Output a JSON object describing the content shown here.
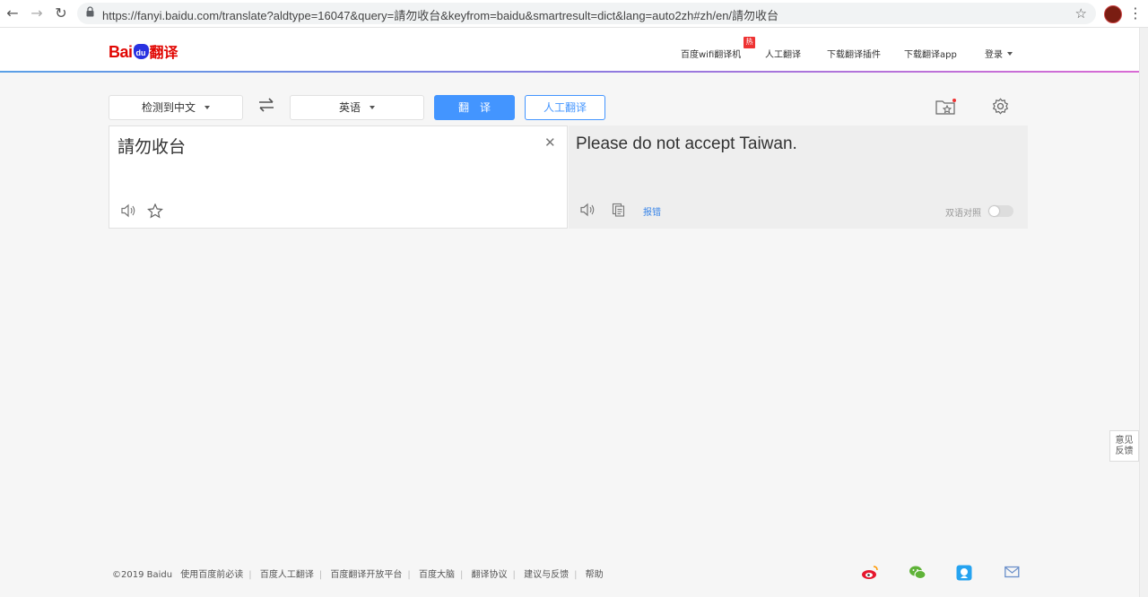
{
  "browser": {
    "url": "https://fanyi.baidu.com/translate?aldtype=16047&query=請勿收台&keyfrom=baidu&smartresult=dict&lang=auto2zh#zh/en/請勿收台",
    "icons": {
      "back": "back-arrow-icon",
      "forward": "forward-arrow-icon",
      "reload": "reload-icon",
      "lock": "lock-icon",
      "bookmark": "star-icon",
      "menu": "kebab-menu-icon"
    }
  },
  "header": {
    "logo": {
      "bai": "Bai",
      "du": "du",
      "fanyi": "翻译"
    },
    "nav": {
      "wifi": "百度wifi翻译机",
      "hot_badge": "热",
      "human": "人工翻译",
      "plugin": "下载翻译插件",
      "app": "下载翻译app",
      "login": "登录"
    }
  },
  "toolbar": {
    "source_lang": "检测到中文",
    "target_lang": "英语",
    "translate": "翻译",
    "human_translate": "人工翻译"
  },
  "input": {
    "text": "請勿收台"
  },
  "output": {
    "text": "Please do not accept Taiwan.",
    "report": "报错",
    "bilingual": "双语对照"
  },
  "feedback": {
    "line1": "意见",
    "line2": "反馈"
  },
  "footer": {
    "copyright": "©2019 Baidu",
    "links": [
      "使用百度前必读",
      "百度人工翻译",
      "百度翻译开放平台",
      "百度大脑",
      "翻译协议",
      "建议与反馈",
      "帮助"
    ]
  },
  "colors": {
    "accent": "#4395ff",
    "brand_red": "#e10602",
    "brand_blue": "#2932e1"
  }
}
